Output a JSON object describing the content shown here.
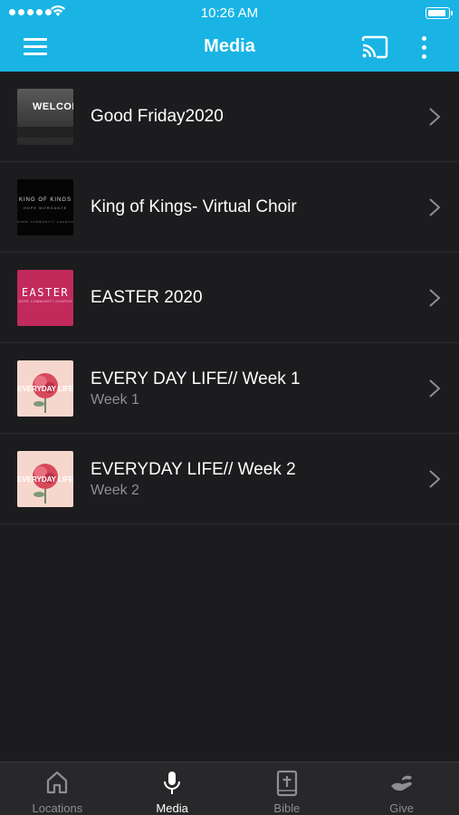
{
  "status_bar": {
    "time": "10:26 AM"
  },
  "header": {
    "title": "Media"
  },
  "media_items": [
    {
      "title": "Good Friday2020",
      "subtitle": "",
      "thumb_text": "WELCOME"
    },
    {
      "title": "King of Kings- Virtual Choir",
      "subtitle": "",
      "thumb_text": "KING OF KINGS",
      "thumb_sub": "HOPE MORGANTE",
      "thumb_foot": "HOPE COMMUNITY CHURCH"
    },
    {
      "title": "EASTER 2020",
      "subtitle": "",
      "thumb_text": "EASTER",
      "thumb_sub": "HOPE COMMUNITY CHURCH"
    },
    {
      "title": "EVERY DAY LIFE// Week 1",
      "subtitle": "Week 1",
      "thumb_text": "EVERYDAY LIFE"
    },
    {
      "title": "EVERYDAY LIFE// Week 2",
      "subtitle": "Week 2",
      "thumb_text": "EVERYDAY LIFE"
    }
  ],
  "tabs": [
    {
      "label": "Locations",
      "icon": "home-icon"
    },
    {
      "label": "Media",
      "icon": "microphone-icon",
      "active": true
    },
    {
      "label": "Bible",
      "icon": "bible-icon"
    },
    {
      "label": "Give",
      "icon": "give-hand-icon"
    }
  ],
  "colors": {
    "accent": "#19b4e4",
    "background": "#1c1c1e",
    "tabbar": "#28282a"
  }
}
